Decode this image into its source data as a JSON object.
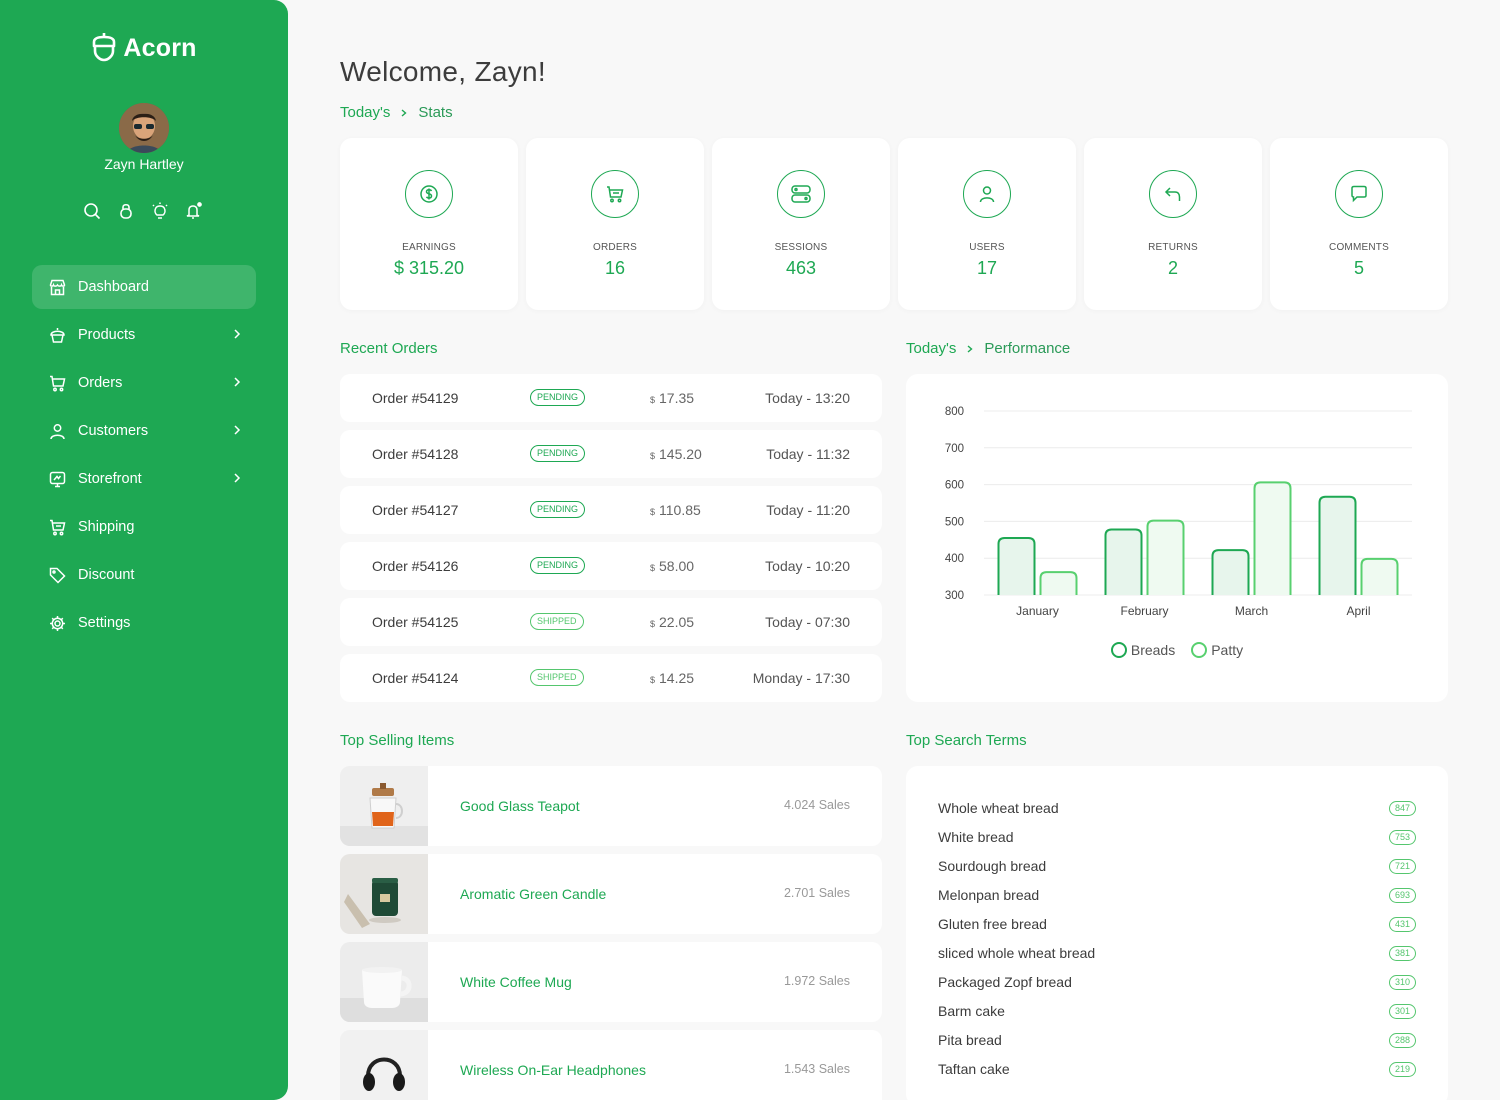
{
  "brand": {
    "name": "Acorn"
  },
  "profile": {
    "name": "Zayn Hartley"
  },
  "sidebar": {
    "items": [
      {
        "label": "Dashboard",
        "icon": "shop-icon",
        "active": true,
        "has_submenu": false
      },
      {
        "label": "Products",
        "icon": "cupcake-icon",
        "active": false,
        "has_submenu": true
      },
      {
        "label": "Orders",
        "icon": "cart-icon",
        "active": false,
        "has_submenu": true
      },
      {
        "label": "Customers",
        "icon": "user-icon",
        "active": false,
        "has_submenu": true
      },
      {
        "label": "Storefront",
        "icon": "monitor-icon",
        "active": false,
        "has_submenu": true
      },
      {
        "label": "Shipping",
        "icon": "shipping-cart-icon",
        "active": false,
        "has_submenu": false
      },
      {
        "label": "Discount",
        "icon": "tag-icon",
        "active": false,
        "has_submenu": false
      },
      {
        "label": "Settings",
        "icon": "gear-icon",
        "active": false,
        "has_submenu": false
      }
    ]
  },
  "header": {
    "welcome": "Welcome, Zayn!",
    "breadcrumb": [
      "Today's",
      "Stats"
    ]
  },
  "stats": [
    {
      "label": "EARNINGS",
      "value": "$ 315.20",
      "icon": "dollar-icon"
    },
    {
      "label": "ORDERS",
      "value": "16",
      "icon": "cart-icon"
    },
    {
      "label": "SESSIONS",
      "value": "463",
      "icon": "server-icon"
    },
    {
      "label": "USERS",
      "value": "17",
      "icon": "user-icon"
    },
    {
      "label": "RETURNS",
      "value": "2",
      "icon": "return-arrow-icon"
    },
    {
      "label": "COMMENTS",
      "value": "5",
      "icon": "message-icon"
    }
  ],
  "recent_orders": {
    "title": "Recent Orders",
    "currency": "$",
    "rows": [
      {
        "id": "Order #54129",
        "status": "PENDING",
        "amount": "17.35",
        "time": "Today - 13:20"
      },
      {
        "id": "Order #54128",
        "status": "PENDING",
        "amount": "145.20",
        "time": "Today - 11:32"
      },
      {
        "id": "Order #54127",
        "status": "PENDING",
        "amount": "110.85",
        "time": "Today - 11:20"
      },
      {
        "id": "Order #54126",
        "status": "PENDING",
        "amount": "58.00",
        "time": "Today - 10:20"
      },
      {
        "id": "Order #54125",
        "status": "SHIPPED",
        "amount": "22.05",
        "time": "Today - 07:30"
      },
      {
        "id": "Order #54124",
        "status": "SHIPPED",
        "amount": "14.25",
        "time": "Monday - 17:30"
      }
    ]
  },
  "performance": {
    "breadcrumb": [
      "Today's",
      "Performance"
    ]
  },
  "chart_data": {
    "type": "bar",
    "categories": [
      "January",
      "February",
      "March",
      "April"
    ],
    "series": [
      {
        "name": "Breads",
        "values": [
          455,
          478,
          422,
          567
        ],
        "color": "#1ea853"
      },
      {
        "name": "Patty",
        "values": [
          362,
          502,
          606,
          398
        ],
        "color": "#58d06f"
      }
    ],
    "ylim": [
      300,
      800
    ],
    "yticks": [
      300,
      400,
      500,
      600,
      700,
      800
    ],
    "grid": true,
    "legend": "bottom"
  },
  "top_selling": {
    "title": "Top Selling Items",
    "items": [
      {
        "name": "Good Glass Teapot",
        "sales": "4.024 Sales",
        "thumb": "teapot"
      },
      {
        "name": "Aromatic Green Candle",
        "sales": "2.701 Sales",
        "thumb": "candle"
      },
      {
        "name": "White Coffee Mug",
        "sales": "1.972 Sales",
        "thumb": "mug"
      },
      {
        "name": "Wireless On-Ear Headphones",
        "sales": "1.543 Sales",
        "thumb": "headphones"
      }
    ]
  },
  "top_search": {
    "title": "Top Search Terms",
    "terms": [
      {
        "term": "Whole wheat bread",
        "count": "847"
      },
      {
        "term": "White bread",
        "count": "753"
      },
      {
        "term": "Sourdough bread",
        "count": "721"
      },
      {
        "term": "Melonpan bread",
        "count": "693"
      },
      {
        "term": "Gluten free bread",
        "count": "431"
      },
      {
        "term": "sliced whole wheat bread",
        "count": "381"
      },
      {
        "term": "Packaged Zopf bread",
        "count": "310"
      },
      {
        "term": "Barm cake",
        "count": "301"
      },
      {
        "term": "Pita bread",
        "count": "288"
      },
      {
        "term": "Taftan cake",
        "count": "219"
      }
    ]
  }
}
